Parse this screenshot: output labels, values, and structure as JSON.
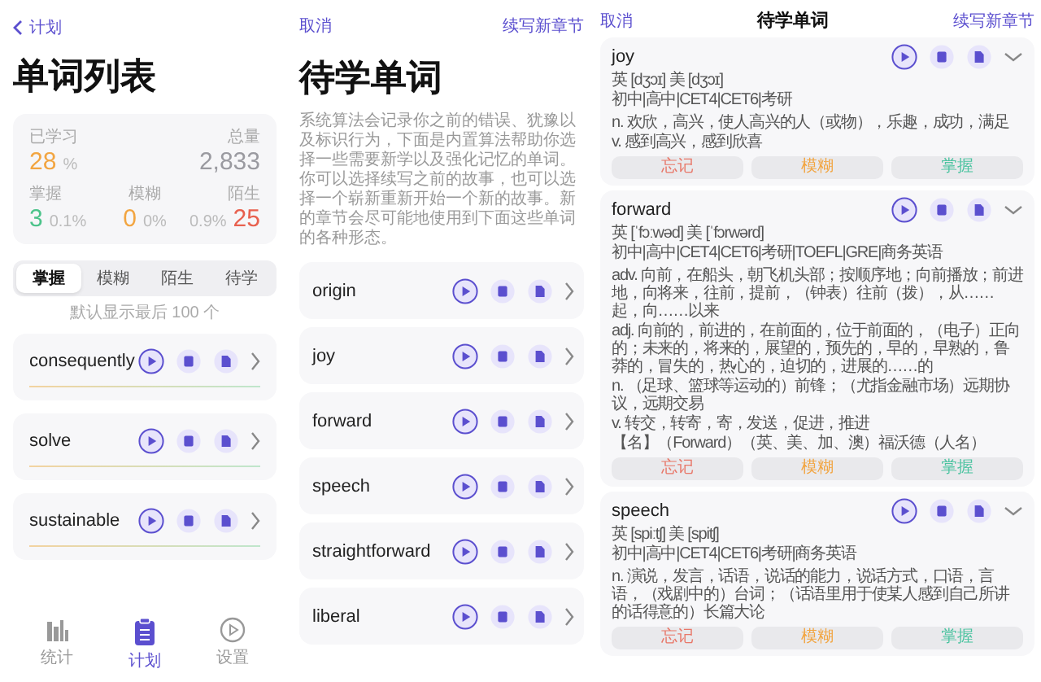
{
  "word_list_screen": {
    "back_link": "计划",
    "title": "单词列表",
    "stats_top": [
      {
        "label": "已学习",
        "value": "28",
        "unit": "%",
        "color": "#f2a541"
      },
      {
        "label": "总量",
        "value": "2,833",
        "color": "#9a9aa0"
      }
    ],
    "stats_bottom": [
      {
        "label": "掌握",
        "value": "3",
        "unit": "0.1%",
        "color": "#4cc38a"
      },
      {
        "label": "模糊",
        "value": "0",
        "unit": "0%",
        "color": "#f2a541"
      },
      {
        "label": "陌生",
        "value": "25",
        "unit": "0.9%",
        "color": "#e8614f"
      }
    ],
    "tabs": [
      {
        "label": "掌握",
        "selected": true
      },
      {
        "label": "模糊",
        "selected": false
      },
      {
        "label": "陌生",
        "selected": false
      },
      {
        "label": "待学",
        "selected": false
      }
    ],
    "hint": "默认显示最后 100 个",
    "words": [
      "consequently",
      "solve",
      "sustainable"
    ],
    "nav": [
      {
        "label": "统计",
        "selected": false,
        "kind": "chart"
      },
      {
        "label": "计划",
        "selected": true,
        "kind": "clipboard"
      },
      {
        "label": "设置",
        "selected": false,
        "kind": "play"
      }
    ]
  },
  "pending_screen": {
    "cancel": "取消",
    "continue": "续写新章节",
    "title": "待学单词",
    "description": "系统算法会记录你之前的错误、犹豫以及标识行为，下面是内置算法帮助你选择一些需要新学以及强化记忆的单词。你可以选择续写之前的故事，也可以选择一个崭新重新开始一个新的故事。新的章节会尽可能地使用到下面这些单词的各种形态。",
    "words": [
      "origin",
      "joy",
      "forward",
      "speech",
      "straightforward",
      "liberal"
    ]
  },
  "detail_screen": {
    "cancel": "取消",
    "title": "待学单词",
    "continue": "续写新章节",
    "cards": [
      {
        "word": "joy",
        "phonetic": "英 [dʒɔɪ]  美 [dʒɔɪ]",
        "levels": "初中|高中|CET4|CET6|考研",
        "definitions": [
          "n. 欢欣，高兴，使人高兴的人（或物），乐趣，成功，满足",
          "v. 感到高兴，感到欣喜"
        ],
        "actions": [
          {
            "label": "忘记",
            "kind": "forget"
          },
          {
            "label": "模糊",
            "kind": "vague"
          },
          {
            "label": "掌握",
            "kind": "master"
          }
        ]
      },
      {
        "word": "forward",
        "phonetic": "英 [ˈfɔːwəd]  美 [ˈfɔrwərd]",
        "levels": "初中|高中|CET4|CET6|考研|TOEFL|GRE|商务英语",
        "definitions": [
          "adv. 向前，在船头，朝飞机头部；按顺序地；向前播放；前进地，向将来，往前，提前，（钟表）往前（拨），从……起，向……以来",
          "adj. 向前的，前进的，在前面的，位于前面的，（电子）正向的；未来的，将来的，展望的，预先的，早的，早熟的，鲁莽的，冒失的，热心的，迫切的，进展的……的",
          "n. （足球、篮球等运动的）前锋；（尤指金融市场）远期协议，远期交易",
          "v. 转交，转寄，寄，发送，促进，推进",
          "【名】（Forward）（英、美、加、澳）福沃德（人名）"
        ],
        "actions": [
          {
            "label": "忘记",
            "kind": "forget"
          },
          {
            "label": "模糊",
            "kind": "vague"
          },
          {
            "label": "掌握",
            "kind": "master"
          }
        ]
      },
      {
        "word": "speech",
        "phonetic": "英 [spiːtʃ]  美 [spitʃ]",
        "levels": "初中|高中|CET4|CET6|考研|商务英语",
        "definitions": [
          "n. 演说，发言，话语，说话的能力，说话方式，口语，言语，（戏剧中的）台词；（话语里用于使某人感到自己所讲的话得意的）长篇大论"
        ],
        "actions": [
          {
            "label": "忘记",
            "kind": "forget"
          },
          {
            "label": "模糊",
            "kind": "vague"
          },
          {
            "label": "掌握",
            "kind": "master"
          }
        ]
      }
    ]
  }
}
